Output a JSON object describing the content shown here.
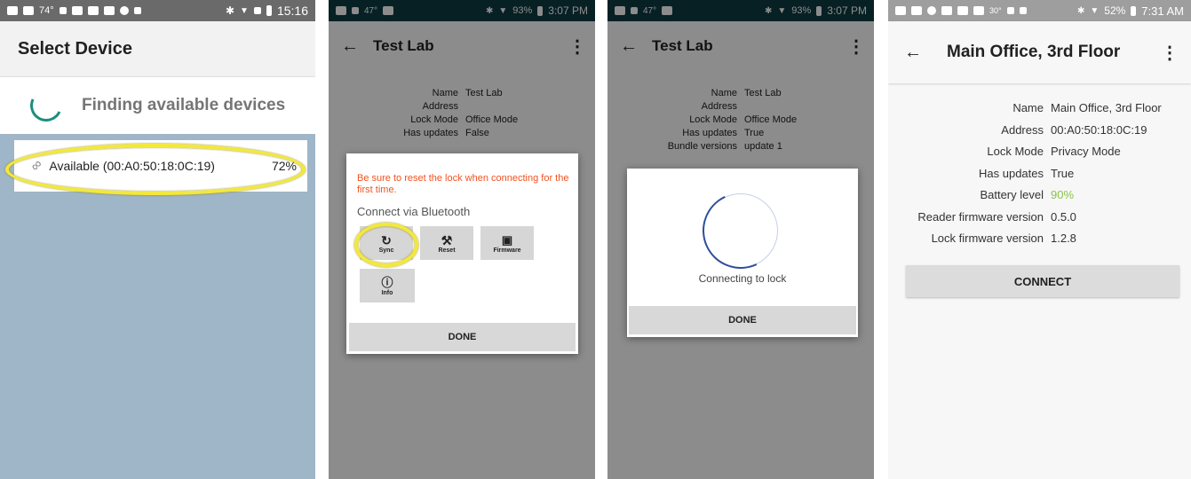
{
  "screen1": {
    "status_time": "15:16",
    "status_temp": "74°",
    "title": "Select Device",
    "finding_text": "Finding available devices",
    "device_label": "Available (00:A0:50:18:0C:19)",
    "device_percent": "72%"
  },
  "screen2": {
    "status_time": "3:07 PM",
    "status_battery": "93%",
    "status_temp": "47°",
    "title": "Test Lab",
    "info_rows": [
      {
        "label": "Name",
        "value": "Test Lab"
      },
      {
        "label": "Address",
        "value": ""
      },
      {
        "label": "Lock Mode",
        "value": "Office Mode"
      },
      {
        "label": "Has updates",
        "value": "False"
      }
    ],
    "dialog": {
      "warning": "Be sure to reset the lock when connecting for the first time.",
      "heading": "Connect via Bluetooth",
      "sync_label": "Sync",
      "reset_label": "Reset",
      "firmware_label": "Firmware",
      "info_label": "Info",
      "done_label": "DONE"
    }
  },
  "screen3": {
    "status_time": "3:07 PM",
    "status_battery": "93%",
    "status_temp": "47°",
    "title": "Test Lab",
    "info_rows": [
      {
        "label": "Name",
        "value": "Test Lab"
      },
      {
        "label": "Address",
        "value": ""
      },
      {
        "label": "Lock Mode",
        "value": "Office Mode"
      },
      {
        "label": "Has updates",
        "value": "True"
      },
      {
        "label": "Bundle versions",
        "value": "update 1"
      }
    ],
    "dialog": {
      "connecting_text": "Connecting to lock",
      "done_label": "DONE"
    }
  },
  "screen4": {
    "status_time": "7:31 AM",
    "status_battery": "52%",
    "status_temp": "30°",
    "title": "Main Office, 3rd Floor",
    "info_rows": [
      {
        "label": "Name",
        "value": "Main Office, 3rd Floor"
      },
      {
        "label": "Address",
        "value": "00:A0:50:18:0C:19"
      },
      {
        "label": "Lock Mode",
        "value": "Privacy Mode"
      },
      {
        "label": "Has updates",
        "value": "True"
      },
      {
        "label": "Battery level",
        "value": "90%"
      },
      {
        "label": "Reader firmware version",
        "value": "0.5.0"
      },
      {
        "label": "Lock firmware version",
        "value": "1.2.8"
      }
    ],
    "connect_label": "CONNECT"
  },
  "colors": {
    "screen1_statusbar": "#6a6a6a",
    "screen1_list_bg": "#9fb5c8",
    "spinner_teal": "#1a8e7e",
    "warning_orange": "#f4511e",
    "battery_green": "#8bc34a",
    "highlight_yellow": "#f3e83b"
  }
}
